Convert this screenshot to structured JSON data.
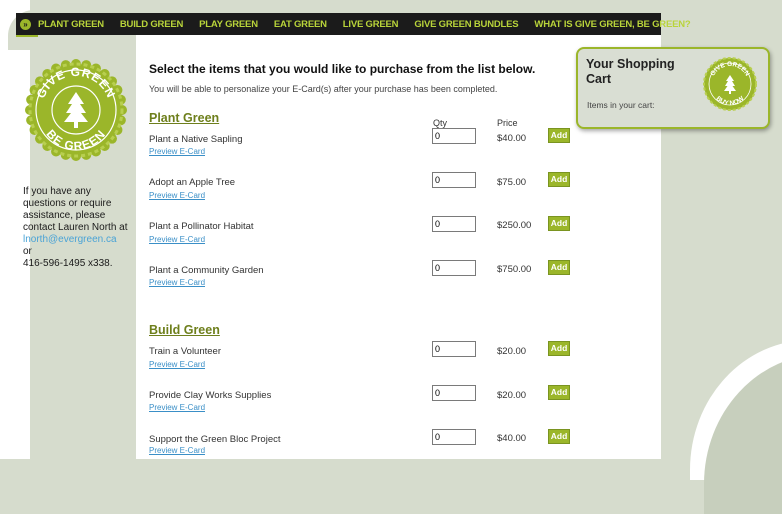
{
  "nav": {
    "items": [
      {
        "label": "PLANT GREEN"
      },
      {
        "label": "BUILD GREEN"
      },
      {
        "label": "PLAY GREEN"
      },
      {
        "label": "EAT GREEN"
      },
      {
        "label": "LIVE GREEN"
      },
      {
        "label": "GIVE GREEN BUNDLES"
      },
      {
        "label": "WHAT IS GIVE GREEN, BE GREEN?"
      }
    ]
  },
  "logo": {
    "top_text": "GIVE GREEN",
    "bottom_text": "BE GREEN"
  },
  "contact": {
    "line1": "If you have any questions or require assistance, please contact Lauren North at",
    "email": "lnorth@evergreen.ca",
    "line2": "or",
    "phone": "416-596-1495 x338."
  },
  "main": {
    "heading": "Select the items that you would like to purchase from the list below.",
    "subheading": "You will be able to personalize your E-Card(s) after your purchase has been completed.",
    "qty_header": "Qty",
    "price_header": "Price",
    "preview_label": "Preview E-Card",
    "add_label": "Add"
  },
  "sections": [
    {
      "title": "Plant Green",
      "items": [
        {
          "name": "Plant a Native Sapling",
          "qty": "0",
          "price": "$40.00"
        },
        {
          "name": "Adopt an Apple Tree",
          "qty": "0",
          "price": "$75.00"
        },
        {
          "name": "Plant a Pollinator Habitat",
          "qty": "0",
          "price": "$250.00"
        },
        {
          "name": "Plant a Community Garden",
          "qty": "0",
          "price": "$750.00"
        }
      ]
    },
    {
      "title": "Build Green",
      "items": [
        {
          "name": "Train a Volunteer",
          "qty": "0",
          "price": "$20.00"
        },
        {
          "name": "Provide Clay Works Supplies",
          "qty": "0",
          "price": "$20.00"
        },
        {
          "name": "Support the Green Bloc Project",
          "qty": "0",
          "price": "$40.00"
        }
      ]
    }
  ],
  "cart": {
    "title": "Your Shopping Cart",
    "subtitle": "Items in your cart:",
    "badge_top": "GIVE GREEN",
    "badge_bottom": "BUY NOW"
  },
  "colors": {
    "accent": "#9bb62a",
    "nav_bg": "#1b1b1b",
    "nav_text": "#b9d43a",
    "section_title": "#6e7f1c",
    "link": "#3a8fc7",
    "page_bg": "#d6dccd"
  }
}
